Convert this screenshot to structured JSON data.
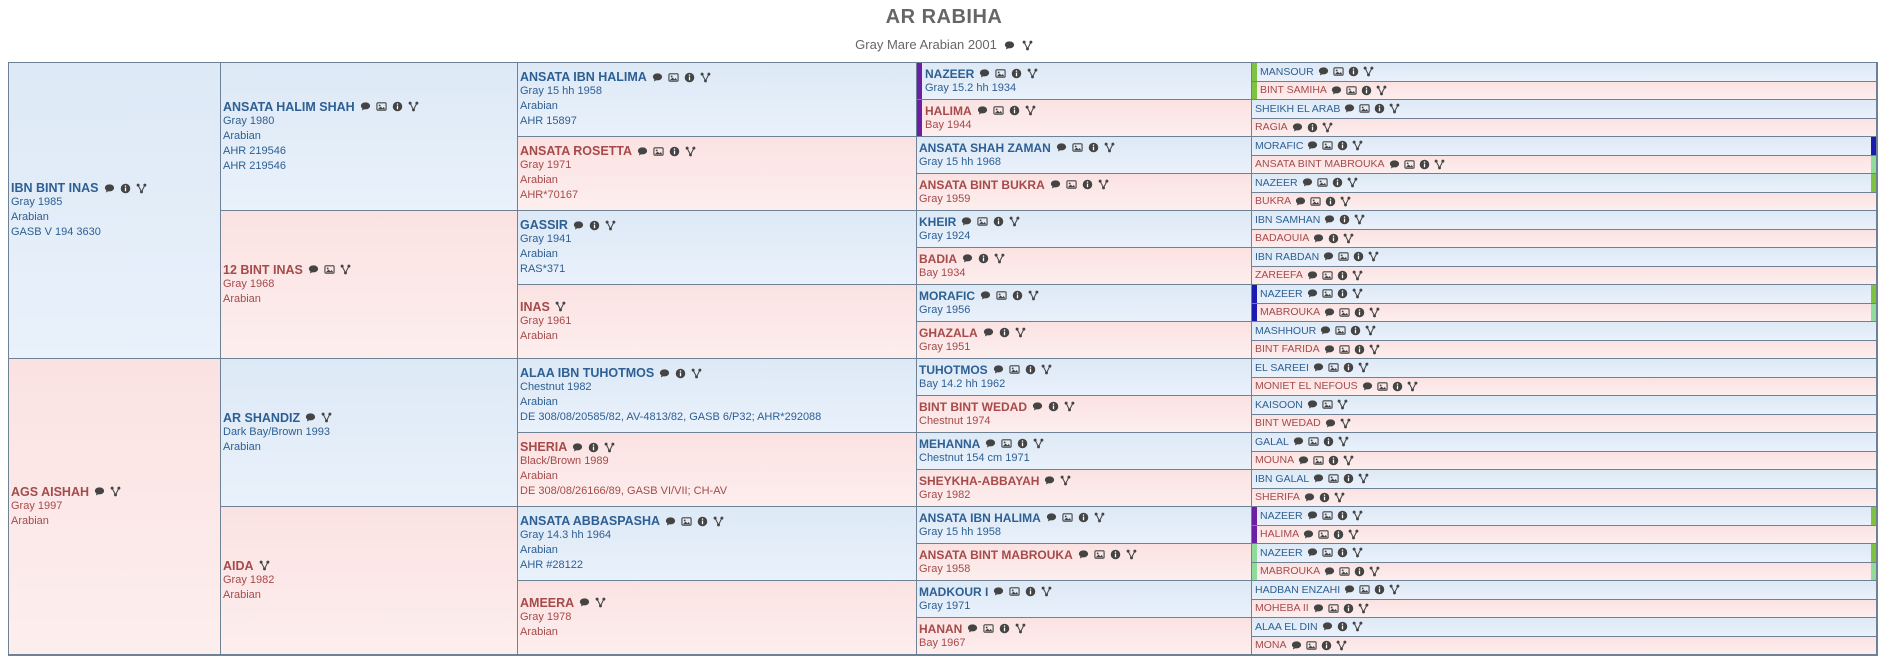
{
  "header": {
    "title": "AR RABIHA",
    "subtitle": "Gray Mare Arabian 2001"
  },
  "colors": {
    "male_text": "#2d5f93",
    "female_text": "#a64a4a",
    "male_bg": "#dde9f6",
    "female_bg": "#fbe2e2",
    "border": "#6f8194",
    "marker_purple": "#6a1fa5",
    "marker_blue": "#1b1bb0",
    "marker_green": "#7ec242",
    "marker_lightgreen": "#8fdb9a"
  },
  "pedigree": [
    {
      "id": "sire",
      "name": "IBN BINT INAS",
      "sex": "m",
      "icons": [
        "comment",
        "info",
        "tree"
      ],
      "lines": [
        "Gray 1985",
        "Arabian",
        "GASB V 194 3630"
      ]
    },
    {
      "id": "dam",
      "name": "AGS AISHAH",
      "sex": "f",
      "icons": [
        "comment",
        "tree"
      ],
      "lines": [
        "Gray 1997",
        "Arabian"
      ]
    },
    {
      "id": "ss",
      "name": "ANSATA HALIM SHAH",
      "sex": "m",
      "icons": [
        "comment",
        "photo",
        "info",
        "tree"
      ],
      "lines": [
        "Gray 1980",
        "Arabian",
        "AHR 219546",
        "AHR 219546"
      ]
    },
    {
      "id": "sd",
      "name": "12 BINT INAS",
      "sex": "f",
      "icons": [
        "comment",
        "photo",
        "tree"
      ],
      "lines": [
        "Gray 1968",
        "Arabian"
      ]
    },
    {
      "id": "ds",
      "name": "AR SHANDIZ",
      "sex": "m",
      "icons": [
        "comment",
        "tree"
      ],
      "lines": [
        "Dark Bay/Brown 1993",
        "Arabian"
      ]
    },
    {
      "id": "dd",
      "name": "AIDA",
      "sex": "f",
      "icons": [
        "tree"
      ],
      "lines": [
        "Gray 1982",
        "Arabian"
      ]
    },
    {
      "id": "g3_0",
      "name": "ANSATA IBN HALIMA",
      "sex": "m",
      "icons": [
        "comment",
        "photo",
        "info",
        "tree"
      ],
      "lines": [
        "Gray 15 hh 1958",
        "Arabian",
        "AHR 15897"
      ]
    },
    {
      "id": "g3_1",
      "name": "ANSATA ROSETTA",
      "sex": "f",
      "icons": [
        "comment",
        "photo",
        "info",
        "tree"
      ],
      "lines": [
        "Gray 1971",
        "Arabian",
        "AHR*70167"
      ]
    },
    {
      "id": "g3_2",
      "name": "GASSIR",
      "sex": "m",
      "icons": [
        "comment",
        "info",
        "tree"
      ],
      "lines": [
        "Gray 1941",
        "Arabian",
        "RAS*371"
      ]
    },
    {
      "id": "g3_3",
      "name": "INAS",
      "sex": "f",
      "icons": [
        "tree"
      ],
      "lines": [
        "Gray 1961",
        "Arabian"
      ]
    },
    {
      "id": "g3_4",
      "name": "ALAA IBN TUHOTMOS",
      "sex": "m",
      "icons": [
        "comment",
        "info",
        "tree"
      ],
      "lines": [
        "Chestnut 1982",
        "Arabian",
        "DE 308/08/20585/82, AV-4813/82, GASB 6/P32; AHR*292088"
      ]
    },
    {
      "id": "g3_5",
      "name": "SHERIA",
      "sex": "f",
      "icons": [
        "comment",
        "info",
        "tree"
      ],
      "lines": [
        "Black/Brown 1989",
        "Arabian",
        "DE 308/08/26166/89, GASB VI/VII; CH-AV"
      ]
    },
    {
      "id": "g3_6",
      "name": "ANSATA ABBASPASHA",
      "sex": "m",
      "icons": [
        "comment",
        "photo",
        "info",
        "tree"
      ],
      "lines": [
        "Gray 14.3 hh 1964",
        "Arabian",
        "AHR #28122"
      ]
    },
    {
      "id": "g3_7",
      "name": "AMEERA",
      "sex": "f",
      "icons": [
        "comment",
        "tree"
      ],
      "lines": [
        "Gray 1978",
        "Arabian"
      ]
    },
    {
      "id": "g4_0",
      "name": "NAZEER",
      "sex": "m",
      "icons": [
        "comment",
        "photo",
        "info",
        "tree"
      ],
      "lines": [
        "Gray 15.2 hh 1934"
      ],
      "marker": "marker_purple"
    },
    {
      "id": "g4_1",
      "name": "HALIMA",
      "sex": "f",
      "icons": [
        "comment",
        "photo",
        "info",
        "tree"
      ],
      "lines": [
        "Bay 1944"
      ],
      "marker": "marker_purple"
    },
    {
      "id": "g4_2",
      "name": "ANSATA SHAH ZAMAN",
      "sex": "m",
      "icons": [
        "comment",
        "photo",
        "info",
        "tree"
      ],
      "lines": [
        "Gray 15 hh 1968"
      ]
    },
    {
      "id": "g4_3",
      "name": "ANSATA BINT BUKRA",
      "sex": "f",
      "icons": [
        "comment",
        "photo",
        "info",
        "tree"
      ],
      "lines": [
        "Gray 1959"
      ]
    },
    {
      "id": "g4_4",
      "name": "KHEIR",
      "sex": "m",
      "icons": [
        "comment",
        "photo",
        "info",
        "tree"
      ],
      "lines": [
        "Gray 1924"
      ]
    },
    {
      "id": "g4_5",
      "name": "BADIA",
      "sex": "f",
      "icons": [
        "comment",
        "info",
        "tree"
      ],
      "lines": [
        "Bay 1934"
      ]
    },
    {
      "id": "g4_6",
      "name": "MORAFIC",
      "sex": "m",
      "icons": [
        "comment",
        "photo",
        "info",
        "tree"
      ],
      "lines": [
        "Gray 1956"
      ]
    },
    {
      "id": "g4_7",
      "name": "GHAZALA",
      "sex": "f",
      "icons": [
        "comment",
        "info",
        "tree"
      ],
      "lines": [
        "Gray 1951"
      ]
    },
    {
      "id": "g4_8",
      "name": "TUHOTMOS",
      "sex": "m",
      "icons": [
        "comment",
        "photo",
        "info",
        "tree"
      ],
      "lines": [
        "Bay 14.2 hh 1962"
      ]
    },
    {
      "id": "g4_9",
      "name": "BINT BINT WEDAD",
      "sex": "f",
      "icons": [
        "comment",
        "info",
        "tree"
      ],
      "lines": [
        "Chestnut 1974"
      ]
    },
    {
      "id": "g4_10",
      "name": "MEHANNA",
      "sex": "m",
      "icons": [
        "comment",
        "photo",
        "info",
        "tree"
      ],
      "lines": [
        "Chestnut 154 cm 1971"
      ]
    },
    {
      "id": "g4_11",
      "name": "SHEYKHA-ABBAYAH",
      "sex": "f",
      "icons": [
        "comment",
        "tree"
      ],
      "lines": [
        "Gray 1982"
      ]
    },
    {
      "id": "g4_12",
      "name": "ANSATA IBN HALIMA",
      "sex": "m",
      "icons": [
        "comment",
        "photo",
        "info",
        "tree"
      ],
      "lines": [
        "Gray 15 hh 1958"
      ]
    },
    {
      "id": "g4_13",
      "name": "ANSATA BINT MABROUKA",
      "sex": "f",
      "icons": [
        "comment",
        "photo",
        "info",
        "tree"
      ],
      "lines": [
        "Gray 1958"
      ]
    },
    {
      "id": "g4_14",
      "name": "MADKOUR I",
      "sex": "m",
      "icons": [
        "comment",
        "photo",
        "info",
        "tree"
      ],
      "lines": [
        "Gray 1971"
      ]
    },
    {
      "id": "g4_15",
      "name": "HANAN",
      "sex": "f",
      "icons": [
        "comment",
        "photo",
        "info",
        "tree"
      ],
      "lines": [
        "Bay 1967"
      ]
    },
    {
      "id": "g5_0",
      "name": "MANSOUR",
      "sex": "m",
      "icons": [
        "comment",
        "photo",
        "info",
        "tree"
      ],
      "marker": "marker_green"
    },
    {
      "id": "g5_1",
      "name": "BINT SAMIHA",
      "sex": "f",
      "icons": [
        "comment",
        "photo",
        "info",
        "tree"
      ],
      "marker": "marker_green"
    },
    {
      "id": "g5_2",
      "name": "SHEIKH EL ARAB",
      "sex": "m",
      "icons": [
        "comment",
        "photo",
        "info",
        "tree"
      ]
    },
    {
      "id": "g5_3",
      "name": "RAGIA",
      "sex": "f",
      "icons": [
        "comment",
        "info",
        "tree"
      ]
    },
    {
      "id": "g5_4",
      "name": "MORAFIC",
      "sex": "m",
      "icons": [
        "comment",
        "photo",
        "info",
        "tree"
      ],
      "rmarker": "marker_blue"
    },
    {
      "id": "g5_5",
      "name": "ANSATA BINT MABROUKA",
      "sex": "f",
      "icons": [
        "comment",
        "photo",
        "info",
        "tree"
      ],
      "rmarker": "marker_lightgreen"
    },
    {
      "id": "g5_6",
      "name": "NAZEER",
      "sex": "m",
      "icons": [
        "comment",
        "photo",
        "info",
        "tree"
      ],
      "rmarker": "marker_green"
    },
    {
      "id": "g5_7",
      "name": "BUKRA",
      "sex": "f",
      "icons": [
        "comment",
        "photo",
        "info",
        "tree"
      ]
    },
    {
      "id": "g5_8",
      "name": "IBN SAMHAN",
      "sex": "m",
      "icons": [
        "comment",
        "info",
        "tree"
      ]
    },
    {
      "id": "g5_9",
      "name": "BADAOUIA",
      "sex": "f",
      "icons": [
        "comment",
        "info",
        "tree"
      ]
    },
    {
      "id": "g5_10",
      "name": "IBN RABDAN",
      "sex": "m",
      "icons": [
        "comment",
        "photo",
        "info",
        "tree"
      ]
    },
    {
      "id": "g5_11",
      "name": "ZAREEFA",
      "sex": "f",
      "icons": [
        "comment",
        "photo",
        "info",
        "tree"
      ]
    },
    {
      "id": "g5_12",
      "name": "NAZEER",
      "sex": "m",
      "icons": [
        "comment",
        "photo",
        "info",
        "tree"
      ],
      "marker": "marker_blue",
      "rmarker": "marker_green"
    },
    {
      "id": "g5_13",
      "name": "MABROUKA",
      "sex": "f",
      "icons": [
        "comment",
        "photo",
        "info",
        "tree"
      ],
      "marker": "marker_blue",
      "rmarker": "marker_lightgreen"
    },
    {
      "id": "g5_14",
      "name": "MASHHOUR",
      "sex": "m",
      "icons": [
        "comment",
        "photo",
        "info",
        "tree"
      ]
    },
    {
      "id": "g5_15",
      "name": "BINT FARIDA",
      "sex": "f",
      "icons": [
        "comment",
        "photo",
        "info",
        "tree"
      ]
    },
    {
      "id": "g5_16",
      "name": "EL SAREEI",
      "sex": "m",
      "icons": [
        "comment",
        "photo",
        "info",
        "tree"
      ]
    },
    {
      "id": "g5_17",
      "name": "MONIET EL NEFOUS",
      "sex": "f",
      "icons": [
        "comment",
        "photo",
        "info",
        "tree"
      ]
    },
    {
      "id": "g5_18",
      "name": "KAISOON",
      "sex": "m",
      "icons": [
        "comment",
        "photo",
        "tree"
      ]
    },
    {
      "id": "g5_19",
      "name": "BINT WEDAD",
      "sex": "f",
      "icons": [
        "comment",
        "tree"
      ]
    },
    {
      "id": "g5_20",
      "name": "GALAL",
      "sex": "m",
      "icons": [
        "comment",
        "photo",
        "info",
        "tree"
      ]
    },
    {
      "id": "g5_21",
      "name": "MOUNA",
      "sex": "f",
      "icons": [
        "comment",
        "photo",
        "info",
        "tree"
      ]
    },
    {
      "id": "g5_22",
      "name": "IBN GALAL",
      "sex": "m",
      "icons": [
        "comment",
        "photo",
        "info",
        "tree"
      ]
    },
    {
      "id": "g5_23",
      "name": "SHERIFA",
      "sex": "f",
      "icons": [
        "comment",
        "info",
        "tree"
      ]
    },
    {
      "id": "g5_24",
      "name": "NAZEER",
      "sex": "m",
      "icons": [
        "comment",
        "photo",
        "info",
        "tree"
      ],
      "marker": "marker_purple",
      "rmarker": "marker_green"
    },
    {
      "id": "g5_25",
      "name": "HALIMA",
      "sex": "f",
      "icons": [
        "comment",
        "photo",
        "info",
        "tree"
      ],
      "marker": "marker_purple"
    },
    {
      "id": "g5_26",
      "name": "NAZEER",
      "sex": "m",
      "icons": [
        "comment",
        "photo",
        "info",
        "tree"
      ],
      "marker": "marker_lightgreen",
      "rmarker": "marker_green"
    },
    {
      "id": "g5_27",
      "name": "MABROUKA",
      "sex": "f",
      "icons": [
        "comment",
        "photo",
        "info",
        "tree"
      ],
      "marker": "marker_lightgreen",
      "rmarker": "marker_lightgreen"
    },
    {
      "id": "g5_28",
      "name": "HADBAN ENZAHI",
      "sex": "m",
      "icons": [
        "comment",
        "photo",
        "info",
        "tree"
      ]
    },
    {
      "id": "g5_29",
      "name": "MOHEBA II",
      "sex": "f",
      "icons": [
        "comment",
        "photo",
        "info",
        "tree"
      ]
    },
    {
      "id": "g5_30",
      "name": "ALAA EL DIN",
      "sex": "m",
      "icons": [
        "comment",
        "info",
        "tree"
      ]
    },
    {
      "id": "g5_31",
      "name": "MONA",
      "sex": "f",
      "icons": [
        "comment",
        "photo",
        "info",
        "tree"
      ]
    }
  ]
}
